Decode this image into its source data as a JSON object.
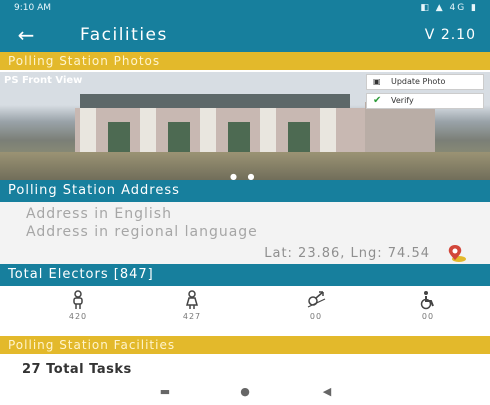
{
  "status_bar": {
    "time": "9:10 AM",
    "icons_text": "◧ ▲ 4G ▮"
  },
  "app_bar": {
    "title": "Facilities",
    "version": "V 2.10",
    "back_icon": "arrow-left-icon"
  },
  "photos_section": {
    "title": "Polling Station Photos",
    "caption": "PS Front View",
    "update_label": "Update Photo",
    "verify_label": "Verify"
  },
  "address_section": {
    "title": "Polling Station Address",
    "english_placeholder": "Address in English",
    "regional_placeholder": "Address in regional language",
    "latlng": "Lat: 23.86, Lng: 74.54"
  },
  "electors": {
    "title": "Total Electors [847]",
    "items": [
      {
        "icon": "male-voter-icon",
        "count": "420"
      },
      {
        "icon": "female-voter-icon",
        "count": "427"
      },
      {
        "icon": "third-gender-icon",
        "count": "00"
      },
      {
        "icon": "disabled-voter-icon",
        "count": "00"
      }
    ]
  },
  "facilities": {
    "title": "Polling Station Facilities",
    "tasks": "27 Total Tasks"
  },
  "colors": {
    "primary": "#177f9d",
    "accent": "#e3b92b",
    "verify": "#2e9c3a"
  }
}
